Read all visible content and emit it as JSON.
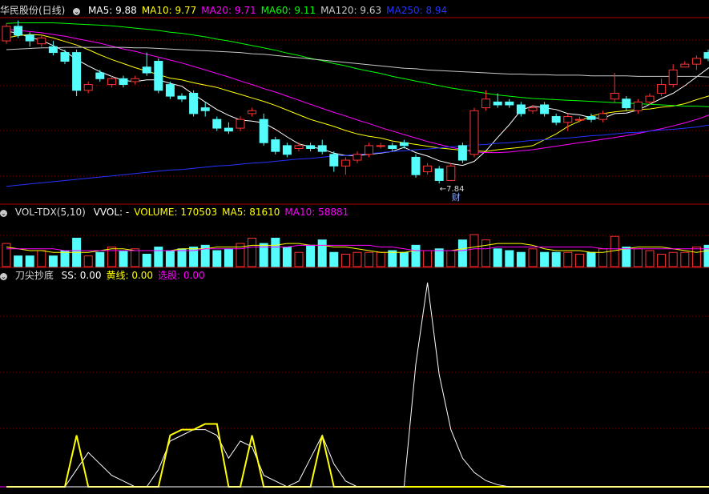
{
  "main_panel": {
    "title": "华民股份(日线)",
    "legend": [
      {
        "label": "MA5: 9.88",
        "color": "#ffffff"
      },
      {
        "label": "MA10: 9.77",
        "color": "#ffff00"
      },
      {
        "label": "MA20: 9.71",
        "color": "#ff00ff"
      },
      {
        "label": "MA60: 9.11",
        "color": "#00ff00"
      },
      {
        "label": "MA120: 9.63",
        "color": "#c8c8c8"
      },
      {
        "label": "MA250: 8.94",
        "color": "#2233ff"
      }
    ],
    "low_marker": "7.84",
    "event_tag": "财"
  },
  "volume_panel": {
    "title": "VOL-TDX(5,10)",
    "legend": [
      {
        "label": "VVOL: -",
        "color": "#ffffff"
      },
      {
        "label": "VOLUME: 170503",
        "color": "#ffff00"
      },
      {
        "label": "MA5: 81610",
        "color": "#ffff00"
      },
      {
        "label": "MA10: 58881",
        "color": "#ff00ff"
      }
    ]
  },
  "indicator_panel": {
    "title": "刀尖抄底",
    "legend": [
      {
        "label": "SS: 0.00",
        "color": "#ffffff"
      },
      {
        "label": "黄线: 0.00",
        "color": "#ffff00"
      },
      {
        "label": "选股: 0.00",
        "color": "#ff00ff"
      }
    ]
  },
  "colors": {
    "up": "#ff3232",
    "down": "#54fcfc",
    "grid": "#7a0000",
    "border": "#b00000"
  },
  "chart_data": {
    "type": "candlestick",
    "candles": [
      [
        10.25,
        10.5,
        10.55,
        10.2
      ],
      [
        10.5,
        10.35,
        10.6,
        10.3
      ],
      [
        10.35,
        10.25,
        10.4,
        10.15
      ],
      [
        10.2,
        10.3,
        10.35,
        10.15
      ],
      [
        10.15,
        10.05,
        10.25,
        10.0
      ],
      [
        10.05,
        9.9,
        10.1,
        9.85
      ],
      [
        10.05,
        9.4,
        10.1,
        9.3
      ],
      [
        9.4,
        9.5,
        9.55,
        9.35
      ],
      [
        9.7,
        9.6,
        9.75,
        9.55
      ],
      [
        9.5,
        9.6,
        9.65,
        9.45
      ],
      [
        9.6,
        9.5,
        9.65,
        9.45
      ],
      [
        9.55,
        9.6,
        9.65,
        9.5
      ],
      [
        9.8,
        9.7,
        10.05,
        9.65
      ],
      [
        9.9,
        9.4,
        9.95,
        9.35
      ],
      [
        9.5,
        9.3,
        9.55,
        9.25
      ],
      [
        9.3,
        9.25,
        9.35,
        9.2
      ],
      [
        9.35,
        9.0,
        9.4,
        8.95
      ],
      [
        9.1,
        9.05,
        9.2,
        8.95
      ],
      [
        8.9,
        8.75,
        8.95,
        8.7
      ],
      [
        8.75,
        8.7,
        8.85,
        8.65
      ],
      [
        8.75,
        8.9,
        8.95,
        8.7
      ],
      [
        9.0,
        9.05,
        9.1,
        8.95
      ],
      [
        8.9,
        8.5,
        9.0,
        8.45
      ],
      [
        8.55,
        8.35,
        8.6,
        8.3
      ],
      [
        8.45,
        8.3,
        8.5,
        8.25
      ],
      [
        8.4,
        8.45,
        8.5,
        8.35
      ],
      [
        8.45,
        8.4,
        8.5,
        8.35
      ],
      [
        8.45,
        8.35,
        8.55,
        8.3
      ],
      [
        8.3,
        8.1,
        8.35,
        8.0
      ],
      [
        8.1,
        8.2,
        8.25,
        7.95
      ],
      [
        8.2,
        8.3,
        8.35,
        8.15
      ],
      [
        8.3,
        8.45,
        8.5,
        8.25
      ],
      [
        8.45,
        8.45,
        8.5,
        8.4
      ],
      [
        8.45,
        8.4,
        8.5,
        8.35
      ],
      [
        8.5,
        8.45,
        8.55,
        8.4
      ],
      [
        8.25,
        7.95,
        8.3,
        7.9
      ],
      [
        8.0,
        8.1,
        8.15,
        7.95
      ],
      [
        8.05,
        7.85,
        8.1,
        7.8
      ],
      [
        7.85,
        8.1,
        8.15,
        7.84
      ],
      [
        8.45,
        8.2,
        8.5,
        8.15
      ],
      [
        8.3,
        9.05,
        9.1,
        8.25
      ],
      [
        9.1,
        9.25,
        9.4,
        9.05
      ],
      [
        9.2,
        9.15,
        9.35,
        9.1
      ],
      [
        9.2,
        9.15,
        9.25,
        9.1
      ],
      [
        9.15,
        9.0,
        9.2,
        8.95
      ],
      [
        9.05,
        9.1,
        9.15,
        9.0
      ],
      [
        9.15,
        9.0,
        9.2,
        8.95
      ],
      [
        8.95,
        8.85,
        9.0,
        8.8
      ],
      [
        8.85,
        8.95,
        9.0,
        8.7
      ],
      [
        8.9,
        8.9,
        8.95,
        8.85
      ],
      [
        8.95,
        8.9,
        9.0,
        8.85
      ],
      [
        8.9,
        9.0,
        9.05,
        8.85
      ],
      [
        9.25,
        9.35,
        9.7,
        9.2
      ],
      [
        9.25,
        9.1,
        9.3,
        9.05
      ],
      [
        9.05,
        9.2,
        9.25,
        9.0
      ],
      [
        9.2,
        9.3,
        9.35,
        9.15
      ],
      [
        9.35,
        9.5,
        9.6,
        9.3
      ],
      [
        9.5,
        9.75,
        9.85,
        9.45
      ],
      [
        9.8,
        9.85,
        9.9,
        9.8
      ],
      [
        9.85,
        9.95,
        10.0,
        9.75
      ],
      [
        10.05,
        9.95,
        10.1,
        9.9
      ],
      [
        10.0,
        10.1,
        10.15,
        9.95
      ],
      [
        10.2,
        10.15,
        10.25,
        9.95
      ],
      [
        10.15,
        9.95,
        10.2,
        9.9
      ]
    ],
    "ma": {
      "MA5": [
        10.42,
        10.38,
        10.31,
        10.26,
        10.17,
        10.07,
        9.93,
        9.82,
        9.72,
        9.64,
        9.57,
        9.55,
        9.58,
        9.58,
        9.52,
        9.47,
        9.33,
        9.2,
        9.07,
        8.97,
        8.89,
        8.87,
        8.84,
        8.73,
        8.6,
        8.48,
        8.43,
        8.39,
        8.32,
        8.28,
        8.28,
        8.3,
        8.32,
        8.35,
        8.42,
        8.33,
        8.27,
        8.19,
        8.14,
        8.11,
        8.18,
        8.36,
        8.59,
        8.81,
        9.06,
        9.13,
        9.1,
        9.07,
        9.0,
        8.98,
        8.93,
        8.92,
        9.0,
        9.01,
        9.06,
        9.16,
        9.26,
        9.35,
        9.48,
        9.63,
        9.78,
        9.9,
        9.98,
        9.99
      ],
      "MA10": [
        10.3,
        10.34,
        10.36,
        10.35,
        10.3,
        10.24,
        10.18,
        10.1,
        10.01,
        9.93,
        9.86,
        9.79,
        9.73,
        9.67,
        9.61,
        9.58,
        9.53,
        9.49,
        9.45,
        9.39,
        9.33,
        9.27,
        9.21,
        9.14,
        9.06,
        8.98,
        8.9,
        8.84,
        8.78,
        8.71,
        8.65,
        8.61,
        8.58,
        8.53,
        8.5,
        8.47,
        8.44,
        8.41,
        8.39,
        8.37,
        8.36,
        8.35,
        8.38,
        8.4,
        8.42,
        8.45,
        8.55,
        8.65,
        8.78,
        8.87,
        8.96,
        9.0,
        9.03,
        9.05,
        9.07,
        9.08,
        9.11,
        9.13,
        9.17,
        9.24,
        9.3,
        9.37,
        9.44,
        9.5
      ],
      "MA20": [
        10.45,
        10.43,
        10.41,
        10.39,
        10.36,
        10.33,
        10.29,
        10.25,
        10.21,
        10.16,
        10.11,
        10.07,
        10.02,
        9.97,
        9.92,
        9.87,
        9.81,
        9.75,
        9.69,
        9.63,
        9.56,
        9.5,
        9.43,
        9.37,
        9.3,
        9.23,
        9.16,
        9.09,
        9.02,
        8.96,
        8.89,
        8.83,
        8.76,
        8.7,
        8.64,
        8.58,
        8.52,
        8.47,
        8.42,
        8.38,
        8.34,
        8.33,
        8.33,
        8.34,
        8.36,
        8.38,
        8.41,
        8.44,
        8.47,
        8.5,
        8.53,
        8.56,
        8.59,
        8.62,
        8.66,
        8.7,
        8.74,
        8.79,
        8.84,
        8.9,
        8.97,
        9.06,
        9.15,
        9.25
      ],
      "MA60": [
        10.55,
        10.56,
        10.56,
        10.56,
        10.56,
        10.55,
        10.54,
        10.53,
        10.52,
        10.51,
        10.49,
        10.47,
        10.45,
        10.43,
        10.4,
        10.38,
        10.35,
        10.32,
        10.28,
        10.25,
        10.21,
        10.17,
        10.13,
        10.09,
        10.04,
        10.0,
        9.95,
        9.91,
        9.86,
        9.82,
        9.77,
        9.73,
        9.69,
        9.64,
        9.6,
        9.56,
        9.52,
        9.48,
        9.44,
        9.41,
        9.38,
        9.35,
        9.32,
        9.3,
        9.28,
        9.26,
        9.25,
        9.24,
        9.23,
        9.22,
        9.21,
        9.2,
        9.19,
        9.18,
        9.17,
        9.16,
        9.15,
        9.14,
        9.13,
        9.13,
        9.12,
        9.12,
        9.11,
        9.11
      ],
      "MA120": [
        10.1,
        10.11,
        10.12,
        10.13,
        10.13,
        10.14,
        10.14,
        10.14,
        10.14,
        10.14,
        10.14,
        10.13,
        10.13,
        10.12,
        10.11,
        10.1,
        10.09,
        10.08,
        10.07,
        10.06,
        10.05,
        10.03,
        10.02,
        10.0,
        9.98,
        9.96,
        9.94,
        9.92,
        9.9,
        9.88,
        9.86,
        9.84,
        9.82,
        9.8,
        9.78,
        9.77,
        9.75,
        9.74,
        9.73,
        9.72,
        9.71,
        9.7,
        9.69,
        9.68,
        9.68,
        9.67,
        9.67,
        9.66,
        9.66,
        9.66,
        9.65,
        9.65,
        9.65,
        9.65,
        9.64,
        9.64,
        9.64,
        9.64,
        9.64,
        9.64,
        9.63,
        9.63,
        9.63,
        9.63
      ],
      "MA250": [
        7.75,
        7.77,
        7.79,
        7.81,
        7.83,
        7.85,
        7.87,
        7.89,
        7.91,
        7.93,
        7.95,
        7.97,
        7.99,
        8.01,
        8.03,
        8.04,
        8.06,
        8.08,
        8.1,
        8.11,
        8.13,
        8.15,
        8.16,
        8.18,
        8.2,
        8.22,
        8.23,
        8.25,
        8.27,
        8.28,
        8.3,
        8.31,
        8.33,
        8.35,
        8.36,
        8.38,
        8.39,
        8.41,
        8.43,
        8.44,
        8.46,
        8.47,
        8.49,
        8.5,
        8.52,
        8.54,
        8.55,
        8.57,
        8.58,
        8.6,
        8.62,
        8.63,
        8.65,
        8.67,
        8.68,
        8.7,
        8.72,
        8.73,
        8.75,
        8.77,
        8.8,
        8.84,
        8.89,
        8.94
      ]
    },
    "volume": [
      13,
      6,
      6,
      9,
      6,
      9,
      16,
      6,
      8,
      11,
      9,
      10,
      7,
      11,
      9,
      10,
      11,
      12,
      9,
      10,
      13,
      16,
      13,
      16,
      11,
      8,
      12,
      15,
      8,
      7,
      8,
      8,
      8,
      9,
      8,
      12,
      9,
      10,
      9,
      15,
      18,
      15,
      10,
      9,
      8,
      10,
      8,
      8,
      8,
      7,
      8,
      10,
      17,
      11,
      10,
      9,
      7,
      8,
      8,
      11,
      12,
      11,
      10,
      9
    ],
    "volume_ma5": [
      11,
      10,
      9,
      9,
      8,
      8,
      8,
      8,
      9,
      10,
      10,
      9,
      9,
      9,
      9,
      10,
      10,
      10,
      11,
      11,
      11,
      12,
      12,
      12,
      13,
      13,
      12,
      12,
      11,
      11,
      10,
      9,
      8,
      8,
      8,
      9,
      9,
      9,
      9,
      10,
      11,
      12,
      13,
      13,
      13,
      12,
      10,
      9,
      9,
      9,
      8,
      8,
      9,
      10,
      11,
      11,
      11,
      10,
      9,
      8,
      9,
      10,
      10,
      10
    ],
    "volume_ma10": [
      10,
      10,
      10,
      10,
      10,
      9,
      9,
      9,
      9,
      9,
      9,
      9,
      9,
      9,
      9,
      9,
      9,
      10,
      10,
      10,
      10,
      11,
      11,
      11,
      11,
      12,
      12,
      12,
      12,
      12,
      12,
      12,
      11,
      11,
      10,
      9,
      9,
      9,
      9,
      9,
      10,
      10,
      11,
      11,
      11,
      11,
      11,
      11,
      11,
      11,
      11,
      10,
      10,
      10,
      10,
      10,
      10,
      10,
      10,
      10,
      10,
      10,
      10,
      10
    ],
    "indicator": {
      "ss": [
        0,
        0,
        0,
        0,
        0,
        0,
        0,
        0,
        0,
        0,
        0,
        0,
        0,
        0,
        0,
        0,
        0,
        0,
        0,
        0,
        0,
        0,
        0,
        0,
        0,
        0,
        0,
        0,
        0,
        0,
        0,
        0,
        0,
        0,
        0,
        60,
        100,
        55,
        28,
        14,
        7,
        3,
        1,
        0,
        0,
        0,
        0,
        0,
        0,
        0,
        0,
        0,
        0,
        0,
        0,
        0,
        0,
        0,
        0,
        0,
        0,
        0,
        0,
        0
      ],
      "white": [
        0,
        0,
        0,
        0,
        0,
        0,
        3,
        6,
        4,
        2,
        1,
        0,
        0,
        3,
        8,
        9,
        10,
        10,
        9,
        5,
        8,
        7,
        2,
        1,
        0,
        1,
        5,
        9,
        4,
        1,
        0,
        0,
        0,
        0,
        0,
        0,
        0,
        0,
        0,
        0,
        0,
        0,
        0,
        0,
        0,
        0,
        0,
        0,
        0,
        0,
        0,
        0,
        0,
        0,
        0,
        0,
        0,
        0,
        0,
        0,
        0,
        0,
        0,
        0
      ],
      "yellow": [
        0,
        0,
        0,
        0,
        0,
        0,
        9,
        0,
        0,
        0,
        0,
        0,
        0,
        0,
        9,
        10,
        10,
        11,
        11,
        0,
        0,
        9,
        0,
        0,
        0,
        0,
        0,
        9,
        0,
        0,
        0,
        0,
        0,
        0,
        0,
        0,
        0,
        0,
        0,
        0,
        0,
        0,
        0,
        0,
        0,
        0,
        0,
        0,
        0,
        0,
        0,
        0,
        0,
        0,
        0,
        0,
        0,
        0,
        0,
        0,
        0,
        0,
        0,
        0
      ]
    }
  }
}
